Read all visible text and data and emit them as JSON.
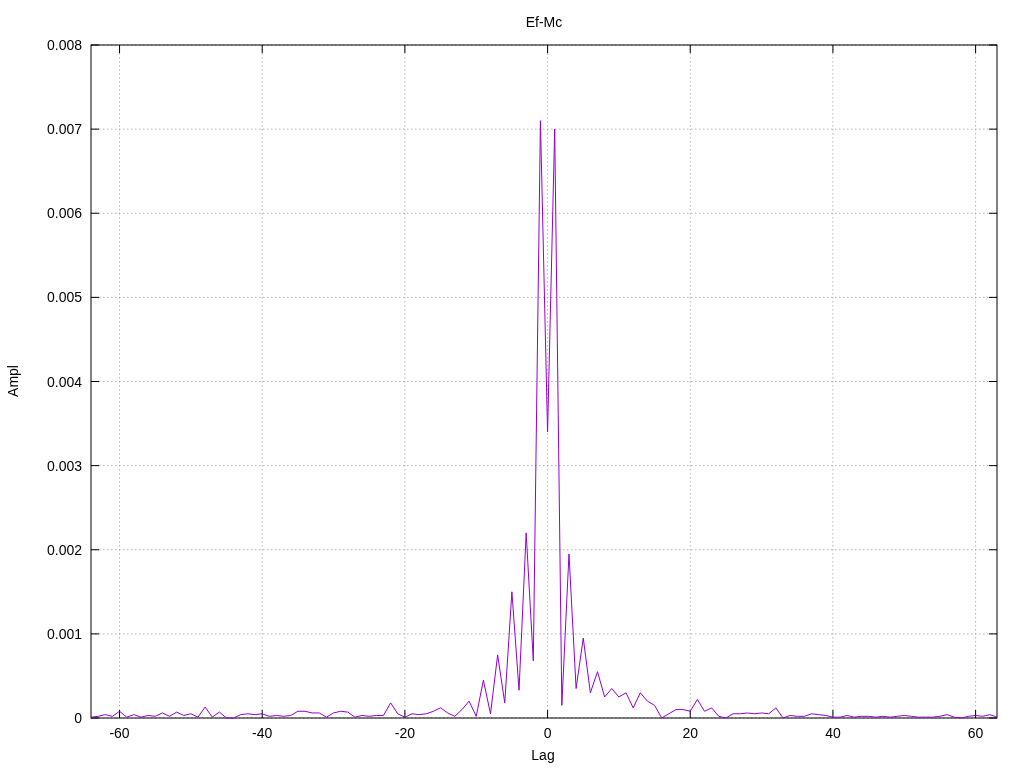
{
  "chart_data": {
    "type": "line",
    "title": "Ef-Mc",
    "xlabel": "Lag",
    "ylabel": "Ampl",
    "xlim": [
      -64,
      63
    ],
    "ylim": [
      0,
      0.008
    ],
    "xticks": [
      -60,
      -40,
      -20,
      0,
      20,
      40,
      60
    ],
    "yticks": [
      0,
      0.001,
      0.002,
      0.003,
      0.004,
      0.005,
      0.006,
      0.007,
      0.008
    ],
    "x": [
      -64,
      -63,
      -62,
      -61,
      -60,
      -59,
      -58,
      -57,
      -56,
      -55,
      -54,
      -53,
      -52,
      -51,
      -50,
      -49,
      -48,
      -47,
      -46,
      -45,
      -44,
      -43,
      -42,
      -41,
      -40,
      -39,
      -38,
      -37,
      -36,
      -35,
      -34,
      -33,
      -32,
      -31,
      -30,
      -29,
      -28,
      -27,
      -26,
      -25,
      -24,
      -23,
      -22,
      -21,
      -20,
      -19,
      -18,
      -17,
      -16,
      -15,
      -14,
      -13,
      -12,
      -11,
      -10,
      -9,
      -8,
      -7,
      -6,
      -5,
      -4,
      -3,
      -2,
      -1,
      0,
      1,
      2,
      3,
      4,
      5,
      6,
      7,
      8,
      9,
      10,
      11,
      12,
      13,
      14,
      15,
      16,
      17,
      18,
      19,
      20,
      21,
      22,
      23,
      24,
      25,
      26,
      27,
      28,
      29,
      30,
      31,
      32,
      33,
      34,
      35,
      36,
      37,
      38,
      39,
      40,
      41,
      42,
      43,
      44,
      45,
      46,
      47,
      48,
      49,
      50,
      51,
      52,
      53,
      54,
      55,
      56,
      57,
      58,
      59,
      60,
      61,
      62,
      63
    ],
    "grid": true,
    "series": [
      {
        "color": "#9400d3",
        "values": [
          1e-05,
          2e-05,
          4e-05,
          2e-05,
          8e-05,
          1e-05,
          4e-05,
          1e-05,
          3e-05,
          2e-05,
          6e-05,
          2e-05,
          7e-05,
          3e-05,
          5e-05,
          1e-05,
          0.00013,
          1e-05,
          7e-05,
          0.0,
          0.0,
          4e-05,
          5e-05,
          4e-05,
          5e-05,
          2e-05,
          3e-05,
          2e-05,
          3e-05,
          8e-05,
          8e-05,
          6e-05,
          6e-05,
          1e-05,
          6e-05,
          8e-05,
          7e-05,
          1e-05,
          3e-05,
          2e-05,
          3e-05,
          3e-05,
          0.00018,
          5e-05,
          1e-05,
          5e-05,
          4e-05,
          5e-05,
          8e-05,
          0.00012,
          6e-05,
          2e-05,
          0.0001,
          0.0002,
          2e-05,
          0.00045,
          5e-05,
          0.00075,
          0.00018,
          0.0015,
          0.00033,
          0.0022,
          0.00068,
          0.0071,
          0.0034,
          0.007,
          0.00015,
          0.00195,
          0.00035,
          0.00095,
          0.0003,
          0.00055,
          0.00025,
          0.00035,
          0.00025,
          0.0003,
          0.00012,
          0.0003,
          0.0002,
          0.00015,
          0.0,
          5e-05,
          0.0001,
          0.0001,
          8e-05,
          0.00022,
          8e-05,
          0.00012,
          2e-05,
          0.0,
          5e-05,
          5e-05,
          6e-05,
          5e-05,
          6e-05,
          5e-05,
          0.00012,
          0.0,
          3e-05,
          2e-05,
          2e-05,
          5e-05,
          4e-05,
          3e-05,
          1e-05,
          1e-05,
          3e-05,
          1e-05,
          2e-05,
          2e-05,
          1e-05,
          2e-05,
          1e-05,
          2e-05,
          3e-05,
          2e-05,
          1e-05,
          1e-05,
          1e-05,
          2e-05,
          4e-05,
          1e-05,
          0.0,
          2e-05,
          3e-05,
          2e-05,
          4e-05,
          1e-05
        ]
      }
    ]
  }
}
